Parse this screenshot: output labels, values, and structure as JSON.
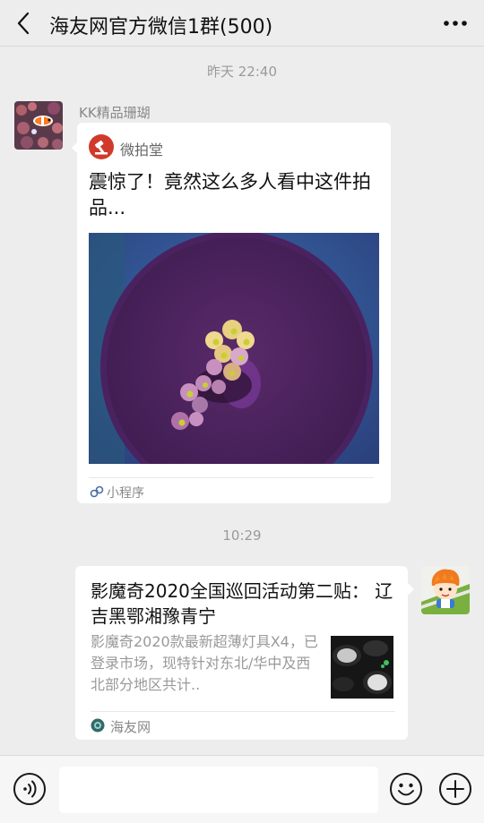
{
  "header": {
    "title": "海友网官方微信1群(500)",
    "back_icon": "chevron-left-icon",
    "more_icon": "more-dots-icon"
  },
  "messages": [
    {
      "timestamp": "昨天 22:40",
      "sender_name": "KK精品珊瑚",
      "card": {
        "source_name": "微拍堂",
        "title": "震惊了！竟然这么多人看中这件拍品...",
        "footer_label": "小程序",
        "footer_icon": "mini-program-icon"
      }
    },
    {
      "timestamp": "10:29",
      "card": {
        "title": "影魔奇2020全国巡回活动第二贴： 辽吉黑鄂湘豫青宁",
        "description": "影魔奇2020款最新超薄灯具X4，已登录市场，现特针对东北/华中及西北部分地区共计..",
        "footer_label": "海友网",
        "footer_icon": "haiyou-logo-icon"
      }
    }
  ],
  "input_bar": {
    "placeholder": "",
    "voice_icon": "voice-icon",
    "emoji_icon": "emoji-icon",
    "plus_icon": "plus-icon"
  },
  "colors": {
    "background": "#ededed",
    "card": "#ffffff",
    "secondary_text": "#888888",
    "logo_red": "#d03a2c"
  }
}
